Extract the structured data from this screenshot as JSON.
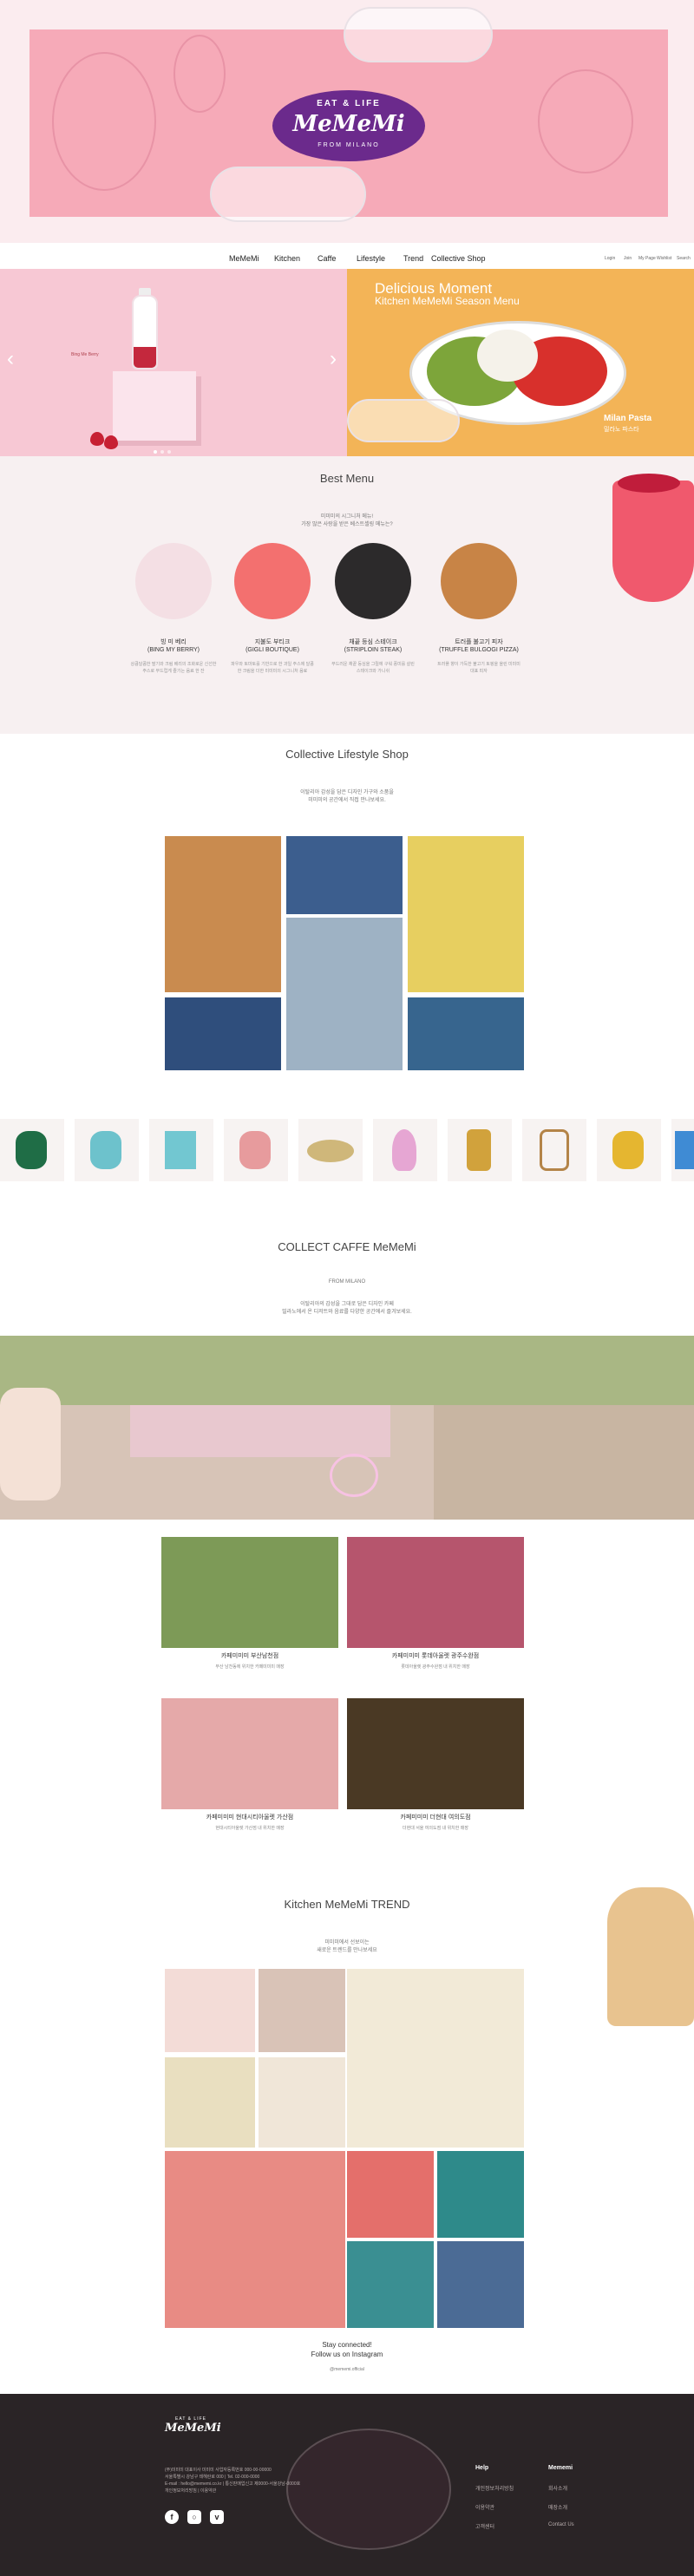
{
  "brand": {
    "top": "EAT & LIFE",
    "name": "MeMeMi",
    "sub": "FROM MILANO"
  },
  "nav": {
    "items": [
      "MeMeMi",
      "Kitchen",
      "Caffe",
      "Lifestyle",
      "Trend",
      "Collective Shop"
    ],
    "utility": [
      "Login",
      "Join",
      "My Page",
      "Wishlist",
      "Search"
    ]
  },
  "banner": {
    "left_caption": "Bing Me Berry",
    "title": "Delicious Moment",
    "subtitle": "Kitchen MeMeMi Season Menu",
    "tag": "Milan Pasta",
    "tag_kr": "밀라노 파스타"
  },
  "best_menu": {
    "title": "Best Menu",
    "desc_line1": "미미미의 시그니처 메뉴!",
    "desc_line2": "가장 많은 사랑을 받은 베스트셀링 메뉴는?",
    "items": [
      {
        "name_kr": "빙 미 베리",
        "name_en": "(BING MY BERRY)",
        "desc": "상큼달콤한 딸기와 크림 베리의 조화로운 신선한 주스로 부드럽게 즐기는 음료 한 잔"
      },
      {
        "name_kr": "지불도 부티크",
        "name_en": "(GIGLI BOUTIQUE)",
        "desc": "파우와 토마토를 기반으로 한 과일 주스에 달콤한 크림을 더한 미미미의 시그니처 음료"
      },
      {
        "name_kr": "채끝 등심 스테이크",
        "name_en": "(STRIPLOIN STEAK)",
        "desc": "부드러운 채끝 등심을 그릴에 구워 풍미를 살린 스테이크와 가니쉬"
      },
      {
        "name_kr": "트러플 불고기 피자",
        "name_en": "(TRUFFLE BULGOGI PIZZA)",
        "desc": "트러플 향이 가득한 불고기 토핑을 올린 미미미 대표 피자"
      }
    ]
  },
  "lifestyle": {
    "title": "Collective Lifestyle Shop",
    "desc_line1": "이탈리아 감성을 담은 디자인 가구와 소품을",
    "desc_line2": "미미미의 공간에서 직접 만나보세요."
  },
  "caffe": {
    "title": "COLLECT CAFFE MeMeMi",
    "sub": "FROM MILANO",
    "desc_line1": "이탈리아의 감성을 그대로 담은 디자인 카페",
    "desc_line2": "밀라노에서 온 디저트와 음료를 다양한 공간에서 즐겨보세요.",
    "stores": [
      {
        "name": "카페미미미 부산남천점",
        "desc": "부산 남천동에 위치한 카페미미미 매장"
      },
      {
        "name": "카페미미미 롯데아울렛 광주수완점",
        "desc": "롯데아울렛 광주수완점 내 위치한 매장"
      },
      {
        "name": "카페미미미 현대시티아울렛 가산점",
        "desc": "현대시티아울렛 가산점 내 위치한 매장"
      },
      {
        "name": "카페미미미 더현대 여의도점",
        "desc": "더현대 서울 여의도점 내 위치한 매장"
      }
    ]
  },
  "trend": {
    "title": "Kitchen MeMeMi TREND",
    "desc_line1": "미미미에서 선보이는",
    "desc_line2": "새로운 트렌드를 만나보세요",
    "stay": "Stay connected!",
    "follow": "Follow us on Instagram",
    "handle": "@mememi.official"
  },
  "footer": {
    "logo_top": "EAT & LIFE",
    "logo_name": "MeMeMi",
    "company": "(주)미미미 대표이사 미미미 사업자등록번호 000-00-00000",
    "address": "서울특별시 강남구 테헤란로 000 | Tel. 02-000-0000",
    "email": "E-mail : hello@mememi.co.kr | 통신판매업신고 제0000-서울강남-0000호",
    "links_note": "개인정보처리방침 | 이용약관",
    "help_head": "Help",
    "help_links": [
      "개인정보처리방침",
      "이용약관",
      "고객센터"
    ],
    "mememi_head": "Mememi",
    "mememi_links": [
      "회사소개",
      "매장소개",
      "Contact Us"
    ]
  },
  "colors": {
    "pink": "#f6aab8",
    "purple": "#6b2a8c",
    "orange": "#f3b457",
    "footer": "#2a2426"
  }
}
